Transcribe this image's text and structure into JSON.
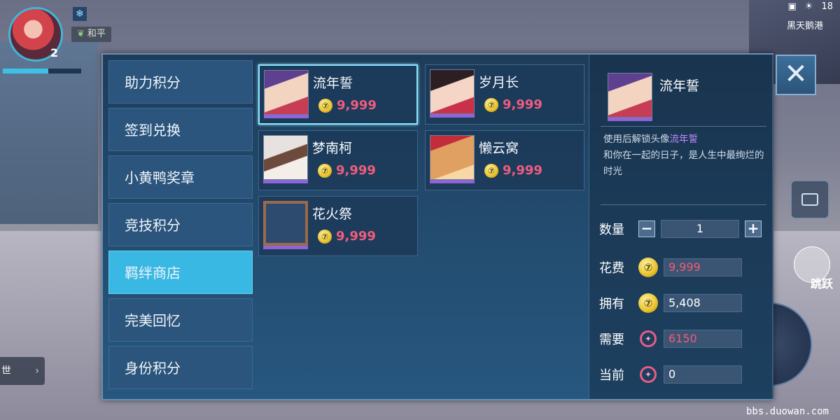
{
  "hud": {
    "level": "2",
    "status": "和平",
    "map_name": "黑天鹅港",
    "time": "18",
    "jump_label": "跳跃",
    "world_label": "世",
    "watermark": "bbs.duowan.com"
  },
  "shop": {
    "tabs": [
      {
        "label": "助力积分",
        "active": false
      },
      {
        "label": "签到兑换",
        "active": false
      },
      {
        "label": "小黄鸭奖章",
        "active": false
      },
      {
        "label": "竞技积分",
        "active": false
      },
      {
        "label": "羁绊商店",
        "active": true
      },
      {
        "label": "完美回忆",
        "active": false
      },
      {
        "label": "身份积分",
        "active": false
      }
    ],
    "items": [
      {
        "name": "流年誓",
        "price": "9,999",
        "avatar": "purple-hair-boy-avatar",
        "selected": true
      },
      {
        "name": "岁月长",
        "price": "9,999",
        "avatar": "flower-girl-avatar",
        "selected": false
      },
      {
        "name": "梦南柯",
        "price": "9,999",
        "avatar": "siamese-cat-avatar",
        "selected": false
      },
      {
        "name": "懒云窝",
        "price": "9,999",
        "avatar": "bow-cat-avatar",
        "selected": false
      },
      {
        "name": "花火祭",
        "price": "9,999",
        "avatar": "festival-frame-avatar",
        "selected": false
      }
    ],
    "detail": {
      "name": "流年誓",
      "desc_prefix": "使用后解锁头像",
      "desc_highlight": "流年誓",
      "desc_body": "和你在一起的日子，是人生中最绚烂的时光",
      "quantity_label": "数量",
      "quantity": "1",
      "cost_label": "花费",
      "cost": "9,999",
      "own_label": "拥有",
      "own": "5,408",
      "need_label": "需要",
      "need": "6150",
      "current_label": "当前",
      "current": "0"
    },
    "close_symbol": "✕"
  },
  "colors": {
    "active_tab": "#38b8e2",
    "price_red": "#ef5d7d",
    "highlight_purple": "#c489ff",
    "selected_border": "#8de6ff"
  }
}
